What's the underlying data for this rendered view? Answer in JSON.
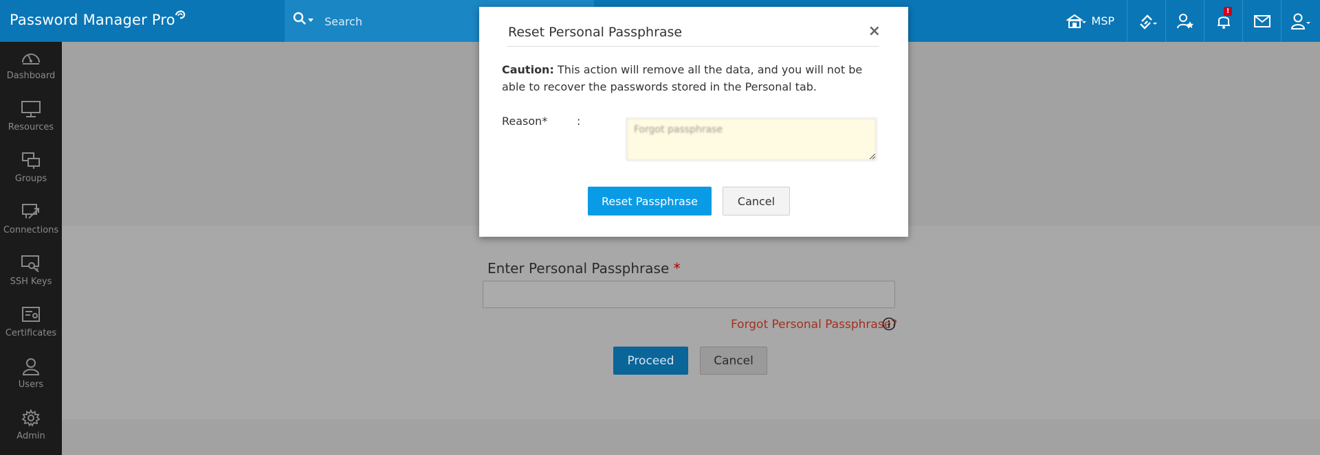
{
  "app": {
    "title": "Password Manager Pro"
  },
  "search": {
    "placeholder": "Search"
  },
  "topbar": {
    "org_label": "MSP",
    "notification_count": "!",
    "accent": "#0a76b6"
  },
  "sidebar": {
    "items": [
      {
        "label": "Dashboard",
        "icon": "dashboard-icon"
      },
      {
        "label": "Resources",
        "icon": "monitor-icon"
      },
      {
        "label": "Groups",
        "icon": "groups-icon"
      },
      {
        "label": "Connections",
        "icon": "connections-icon"
      },
      {
        "label": "SSH Keys",
        "icon": "ssh-key-icon"
      },
      {
        "label": "Certificates",
        "icon": "certificate-icon"
      },
      {
        "label": "Users",
        "icon": "user-icon"
      },
      {
        "label": "Admin",
        "icon": "gear-icon"
      }
    ]
  },
  "main": {
    "passphrase_label": "Enter Personal Passphrase",
    "required_mark": "*",
    "forgot_link": "Forgot Personal Passphrase?",
    "proceed_label": "Proceed",
    "cancel_label": "Cancel"
  },
  "modal": {
    "title": "Reset Personal Passphrase",
    "close_glyph": "×",
    "caution_label": "Caution:",
    "caution_text": " This action will remove all the data, and you will not be able to recover the passwords stored in the Personal tab.",
    "reason_label": "Reason*",
    "reason_colon": ":",
    "reason_value": "Forgot passphrase",
    "reset_label": "Reset Passphrase",
    "cancel_label": "Cancel",
    "primary_color": "#0a9be6"
  }
}
